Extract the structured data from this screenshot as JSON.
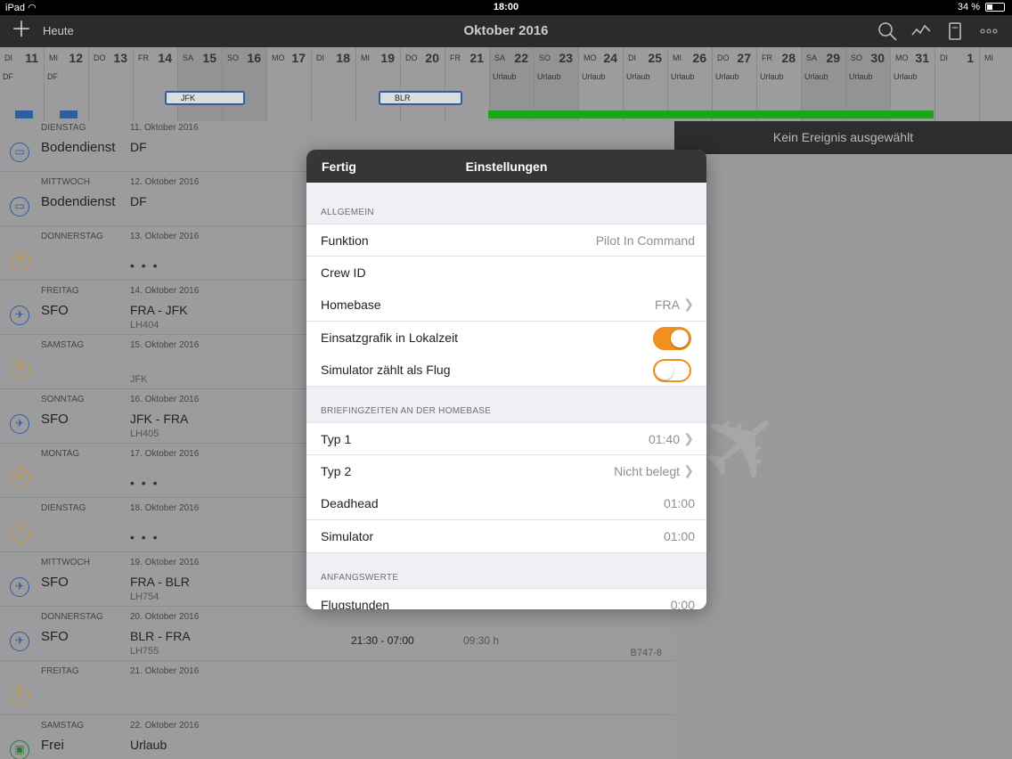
{
  "status": {
    "device": "iPad",
    "time": "18:00",
    "battery": "34 %",
    "battery_level": 0.34
  },
  "nav": {
    "today_label": "Heute",
    "title": "Oktober 2016"
  },
  "calendar": {
    "days": [
      {
        "wd": "DI",
        "d": "11",
        "label": "DF",
        "weekend": false
      },
      {
        "wd": "MI",
        "d": "12",
        "label": "DF",
        "weekend": false
      },
      {
        "wd": "DO",
        "d": "13",
        "label": "",
        "weekend": false
      },
      {
        "wd": "FR",
        "d": "14",
        "label": "",
        "weekend": false
      },
      {
        "wd": "SA",
        "d": "15",
        "label": "",
        "weekend": true
      },
      {
        "wd": "SO",
        "d": "16",
        "label": "",
        "weekend": true
      },
      {
        "wd": "MO",
        "d": "17",
        "label": "",
        "weekend": false
      },
      {
        "wd": "DI",
        "d": "18",
        "label": "",
        "weekend": false
      },
      {
        "wd": "MI",
        "d": "19",
        "label": "",
        "weekend": false
      },
      {
        "wd": "DO",
        "d": "20",
        "label": "",
        "weekend": false
      },
      {
        "wd": "FR",
        "d": "21",
        "label": "",
        "weekend": false
      },
      {
        "wd": "SA",
        "d": "22",
        "label": "Urlaub",
        "weekend": true
      },
      {
        "wd": "SO",
        "d": "23",
        "label": "Urlaub",
        "weekend": true
      },
      {
        "wd": "MO",
        "d": "24",
        "label": "Urlaub",
        "weekend": false
      },
      {
        "wd": "DI",
        "d": "25",
        "label": "Urlaub",
        "weekend": false
      },
      {
        "wd": "MI",
        "d": "26",
        "label": "Urlaub",
        "weekend": false
      },
      {
        "wd": "DO",
        "d": "27",
        "label": "Urlaub",
        "weekend": false
      },
      {
        "wd": "FR",
        "d": "28",
        "label": "Urlaub",
        "weekend": false
      },
      {
        "wd": "SA",
        "d": "29",
        "label": "Urlaub",
        "weekend": true
      },
      {
        "wd": "SO",
        "d": "30",
        "label": "Urlaub",
        "weekend": true
      },
      {
        "wd": "MO",
        "d": "31",
        "label": "Urlaub",
        "weekend": false
      },
      {
        "wd": "DI",
        "d": "1",
        "label": "",
        "weekend": false
      },
      {
        "wd": "MI",
        "d": "",
        "label": "",
        "weekend": false
      }
    ],
    "trip1_label": "JFK",
    "trip2_label": "BLR"
  },
  "list": [
    {
      "wd": "DIENSTAG",
      "date": "11. Oktober 2016",
      "type": "Bodendienst",
      "route": "DF",
      "icon": "monitor",
      "time": "",
      "dur": "",
      "ac": "",
      "flight": "",
      "dots": false
    },
    {
      "wd": "MITTWOCH",
      "date": "12. Oktober 2016",
      "type": "Bodendienst",
      "route": "DF",
      "icon": "monitor",
      "time": "",
      "dur": "",
      "ac": "",
      "flight": "",
      "dots": false
    },
    {
      "wd": "DONNERSTAG",
      "date": "13. Oktober 2016",
      "type": "",
      "route": "",
      "icon": "add",
      "time": "",
      "dur": "",
      "ac": "",
      "flight": "",
      "dots": true
    },
    {
      "wd": "FREITAG",
      "date": "14. Oktober 2016",
      "type": "SFO",
      "route": "FRA - JFK",
      "icon": "plane",
      "time": "",
      "dur": "",
      "ac": "",
      "flight": "LH404",
      "dots": false
    },
    {
      "wd": "SAMSTAG",
      "date": "15. Oktober 2016",
      "type": "",
      "route": "",
      "icon": "add",
      "time": "",
      "dur": "",
      "ac": "",
      "flight": "JFK",
      "dots": false
    },
    {
      "wd": "SONNTAG",
      "date": "16. Oktober 2016",
      "type": "SFO",
      "route": "JFK - FRA",
      "icon": "plane",
      "time": "",
      "dur": "",
      "ac": "",
      "flight": "LH405",
      "dots": false
    },
    {
      "wd": "MONTAG",
      "date": "17. Oktober 2016",
      "type": "",
      "route": "",
      "icon": "add",
      "time": "",
      "dur": "",
      "ac": "",
      "flight": "",
      "dots": true
    },
    {
      "wd": "DIENSTAG",
      "date": "18. Oktober 2016",
      "type": "",
      "route": "",
      "icon": "add",
      "time": "",
      "dur": "",
      "ac": "",
      "flight": "",
      "dots": true
    },
    {
      "wd": "MITTWOCH",
      "date": "19. Oktober 2016",
      "type": "SFO",
      "route": "FRA - BLR",
      "icon": "plane",
      "time": "",
      "dur": "",
      "ac": "",
      "flight": "LH754",
      "dots": false
    },
    {
      "wd": "DONNERSTAG",
      "date": "20. Oktober 2016",
      "type": "SFO",
      "route": "BLR - FRA",
      "icon": "plane",
      "time": "21:30 - 07:00",
      "dur": "09:30 h",
      "ac": "B747-8",
      "flight": "LH755",
      "dots": false
    },
    {
      "wd": "FREITAG",
      "date": "21. Oktober 2016",
      "type": "",
      "route": "",
      "icon": "add",
      "time": "",
      "dur": "",
      "ac": "",
      "flight": "",
      "dots": false
    },
    {
      "wd": "SAMSTAG",
      "date": "22. Oktober 2016",
      "type": "Frei",
      "route": "Urlaub",
      "icon": "off",
      "time": "",
      "dur": "",
      "ac": "",
      "flight": "",
      "dots": false
    }
  ],
  "detail": {
    "empty_label": "Kein Ereignis ausgewählt"
  },
  "modal": {
    "done_label": "Fertig",
    "title": "Einstellungen",
    "section_general": "ALLGEMEIN",
    "funktion_label": "Funktion",
    "funktion_value": "Pilot In Command",
    "crew_label": "Crew ID",
    "homebase_label": "Homebase",
    "homebase_value": "FRA",
    "local_label": "Einsatzgrafik in Lokalzeit",
    "local_on": true,
    "sim_label": "Simulator zählt als Flug",
    "sim_on": false,
    "section_briefing": "BRIEFINGZEITEN AN DER HOMEBASE",
    "typ1_label": "Typ 1",
    "typ1_value": "01:40",
    "typ2_label": "Typ 2",
    "typ2_value": "Nicht belegt",
    "deadhead_label": "Deadhead",
    "deadhead_value": "01:00",
    "simulator_label": "Simulator",
    "simulator_value": "01:00",
    "section_start": "ANFANGSWERTE",
    "flight_hours_label": "Flugstunden",
    "flight_hours_value": "0:00"
  },
  "colors": {
    "accent": "#f0901e",
    "flight_block": "#2f5e9c",
    "vacation": "#1aa51a"
  }
}
